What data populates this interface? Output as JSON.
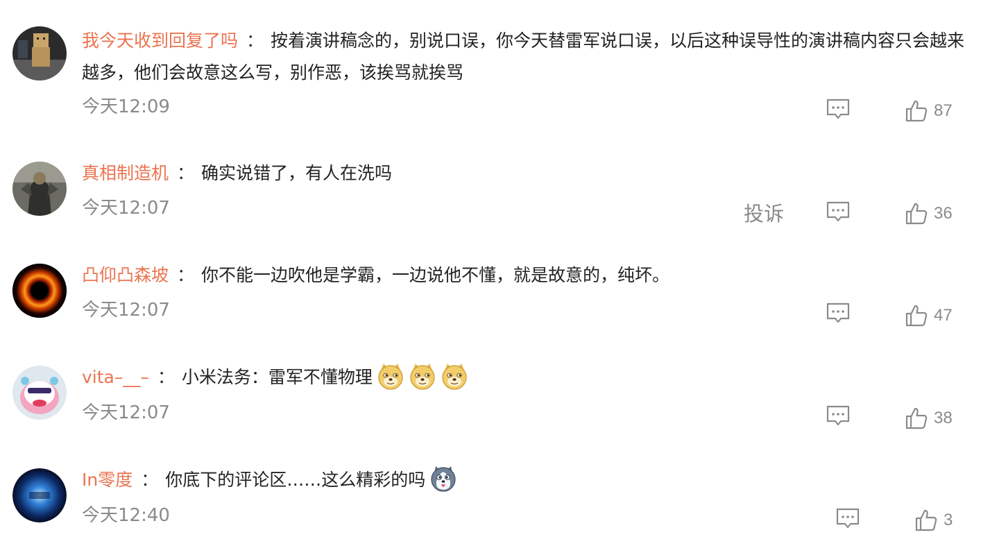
{
  "comments": [
    {
      "username": "我今天收到回复了吗",
      "separator": "：",
      "text": "按着演讲稿念的，别说口误，你今天替雷军说口误，以后这种误导性的演讲稿内容只会越来越多，他们会故意这么写，别作恶，该挨骂就挨骂",
      "time": "今天12:09",
      "likes": "87",
      "avatar": "figure-doll-avatar"
    },
    {
      "username": "真相制造机",
      "separator": "：",
      "text": "确实说错了，有人在洗吗",
      "time": "今天12:07",
      "report_label": "投诉",
      "likes": "36",
      "avatar": "armored-figure-avatar"
    },
    {
      "username": "凸仰凸森坡",
      "separator": "：",
      "text": "你不能一边吹他是学霸，一边说他不懂，就是故意的，纯坏。",
      "time": "今天12:07",
      "likes": "47",
      "avatar": "black-hole-avatar"
    },
    {
      "username": "vita–__–",
      "separator": "：",
      "text": "小米法务：雷军不懂物理",
      "emojis": [
        "doge-emoji",
        "doge-emoji",
        "doge-emoji"
      ],
      "time": "今天12:07",
      "likes": "38",
      "avatar": "cartoon-avatar"
    },
    {
      "username": "In零度",
      "separator": "：",
      "text": "你底下的评论区……这么精彩的吗",
      "emojis": [
        "husky-emoji"
      ],
      "time": "今天12:40",
      "likes": "3",
      "avatar": "blue-glow-avatar"
    }
  ],
  "colors": {
    "username": "#eb7350",
    "body_text": "#222222",
    "meta_text": "#8a8a8a",
    "icon": "#8a8a8a"
  },
  "icons": {
    "reply": "comment-bubble-icon",
    "like": "thumbs-up-icon"
  }
}
